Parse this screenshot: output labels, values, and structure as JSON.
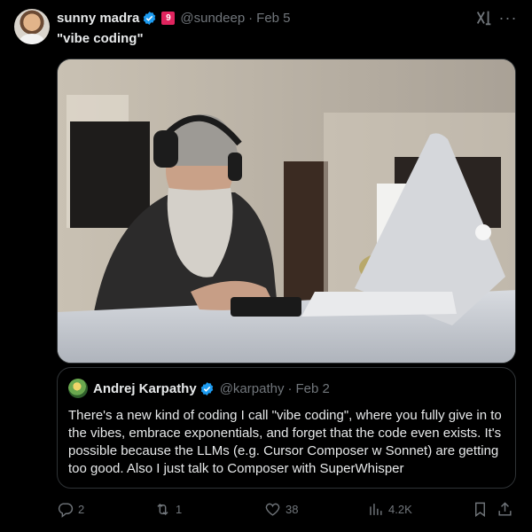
{
  "author": {
    "display_name": "sunny madra",
    "badge_label": "9",
    "handle": "@sundeep",
    "date": "Feb 5"
  },
  "tweet_text": "\"vibe coding\"",
  "quoted": {
    "display_name": "Andrej Karpathy",
    "handle": "@karpathy",
    "date": "Feb 2",
    "text": "There's a new kind of coding I call \"vibe coding\", where you fully give in to the vibes, embrace exponentials, and forget that the code even exists. It's possible because the LLMs (e.g. Cursor Composer w Sonnet) are getting too good. Also I just talk to Composer with SuperWhisper"
  },
  "actions": {
    "replies": "2",
    "reposts": "1",
    "likes": "38",
    "views": "4.2K"
  },
  "separator": "·",
  "colors": {
    "background": "#000000",
    "text": "#e7e9ea",
    "muted": "#71767b",
    "verified": "#1d9bf0",
    "border": "#2f3336"
  },
  "icons": [
    "verified-icon",
    "grok-icon",
    "more-icon",
    "reply-icon",
    "repost-icon",
    "like-icon",
    "views-icon",
    "bookmark-icon",
    "share-icon"
  ]
}
